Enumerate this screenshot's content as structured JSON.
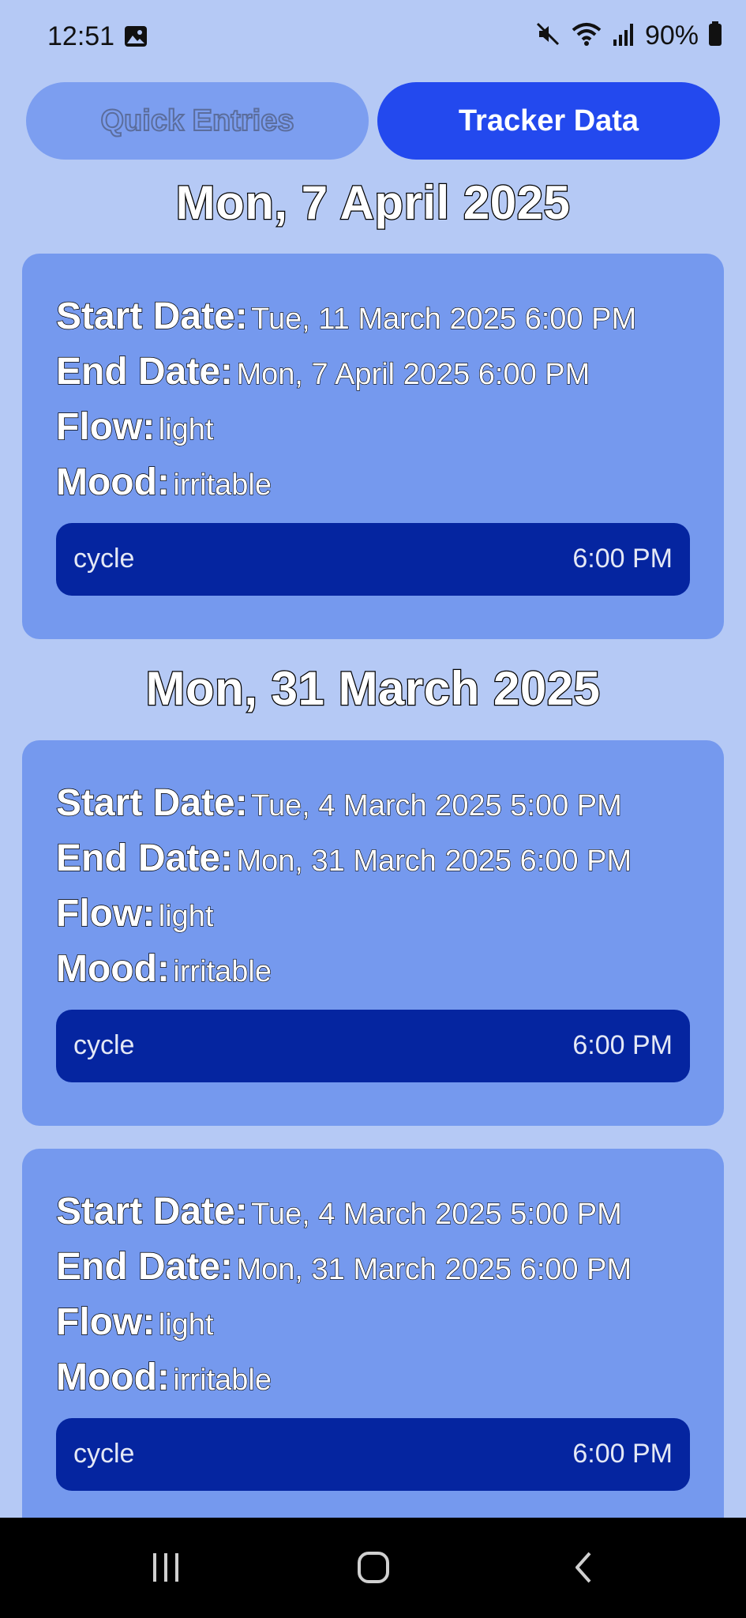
{
  "status_bar": {
    "time": "12:51",
    "battery": "90%",
    "icons": [
      "image-icon",
      "mute-icon",
      "wifi-icon",
      "signal-icon",
      "battery-icon"
    ]
  },
  "toggle": {
    "quick_label": "Quick Entries",
    "tracker_label": "Tracker Data",
    "active": "Tracker Data"
  },
  "labels": {
    "start": "Start Date:",
    "end": "End Date:",
    "flow": "Flow:",
    "mood": "Mood:"
  },
  "groups": [
    {
      "heading": "Mon, 7 April 2025",
      "entries": [
        {
          "start": "Tue, 11 March 2025 6:00 PM",
          "end": "Mon, 7 April 2025 6:00 PM",
          "flow": "light",
          "mood": "irritable",
          "tag": "cycle",
          "time": "6:00 PM"
        }
      ]
    },
    {
      "heading": "Mon, 31 March 2025",
      "entries": [
        {
          "start": "Tue, 4 March 2025 5:00 PM",
          "end": "Mon, 31 March 2025 6:00 PM",
          "flow": "light",
          "mood": "irritable",
          "tag": "cycle",
          "time": "6:00 PM"
        },
        {
          "start": "Tue, 4 March 2025 5:00 PM",
          "end": "Mon, 31 March 2025 6:00 PM",
          "flow": "light",
          "mood": "irritable",
          "tag": "cycle",
          "time": "6:00 PM"
        }
      ]
    }
  ],
  "colors": {
    "background": "#b5c9f5",
    "card": "#7599ee",
    "entry_bar": "#0525a0",
    "active_tab": "#2349ee",
    "inactive_tab": "#7c9ef0"
  }
}
